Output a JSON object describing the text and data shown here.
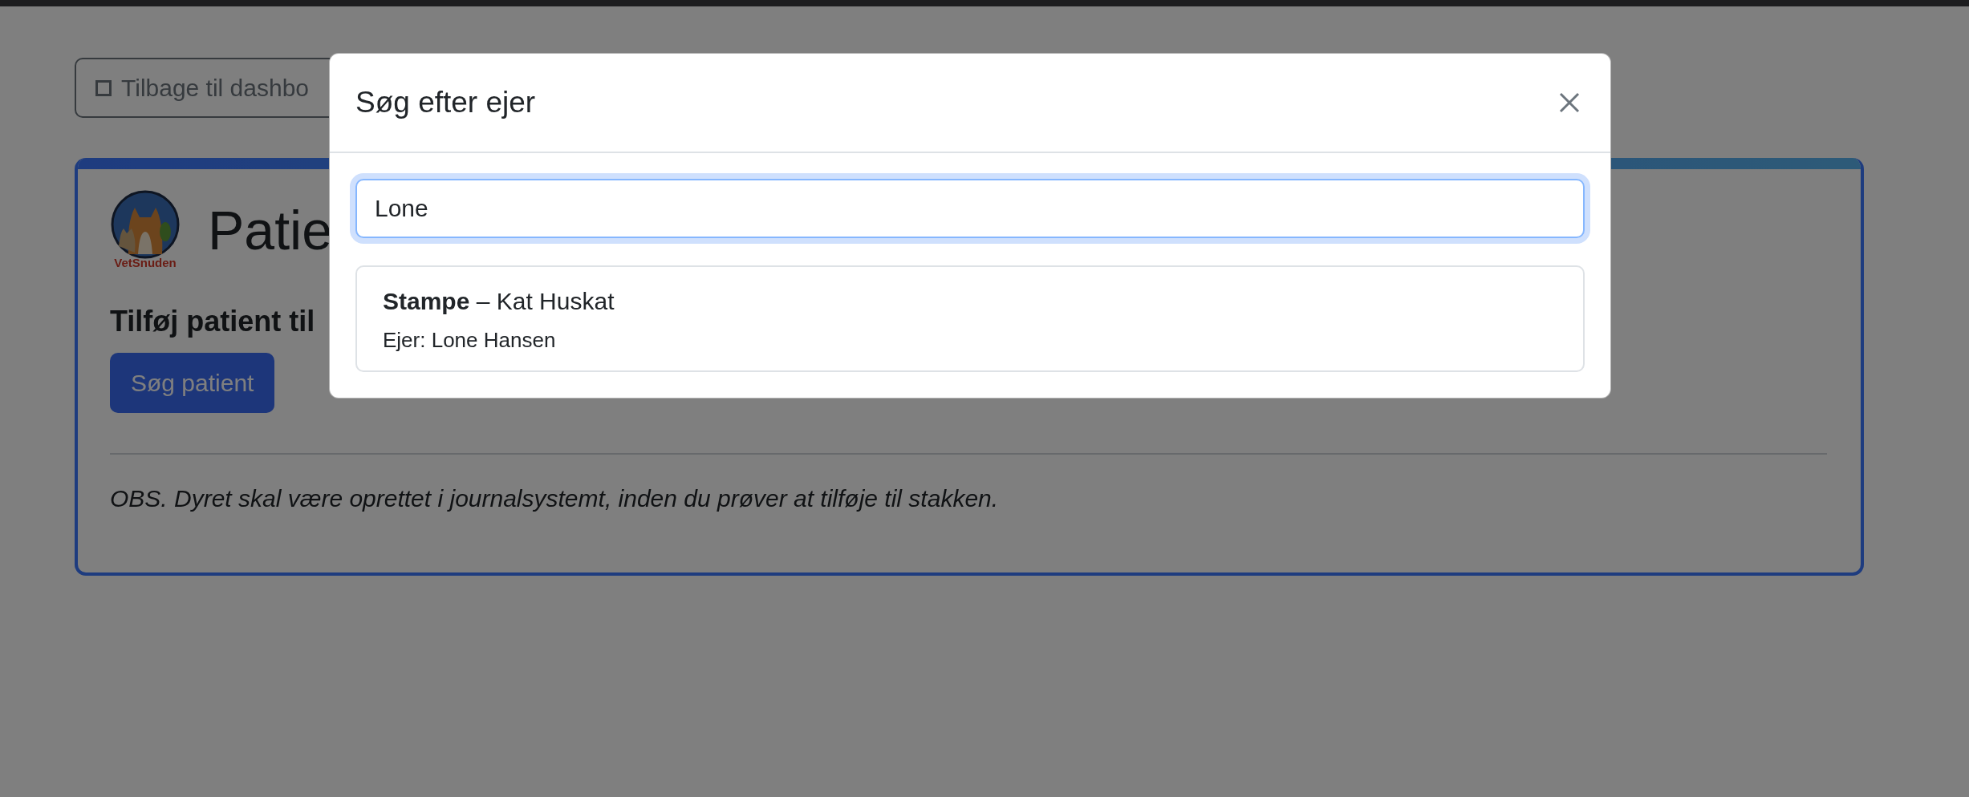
{
  "back_button": {
    "label": "Tilbage til dashbo"
  },
  "card": {
    "logo_text": "VetSnuden",
    "title": "Patie",
    "subtitle": "Tilføj patient til",
    "search_button": "Søg patient",
    "note": "OBS. Dyret skal være oprettet i journalsystemt, inden du prøver at tilføje til stakken."
  },
  "modal": {
    "title": "Søg efter ejer",
    "search": {
      "value": "Lone"
    },
    "results": [
      {
        "title": "**Stampe** – Kat Huskat",
        "owner": "Ejer: Lone Hansen"
      }
    ]
  }
}
